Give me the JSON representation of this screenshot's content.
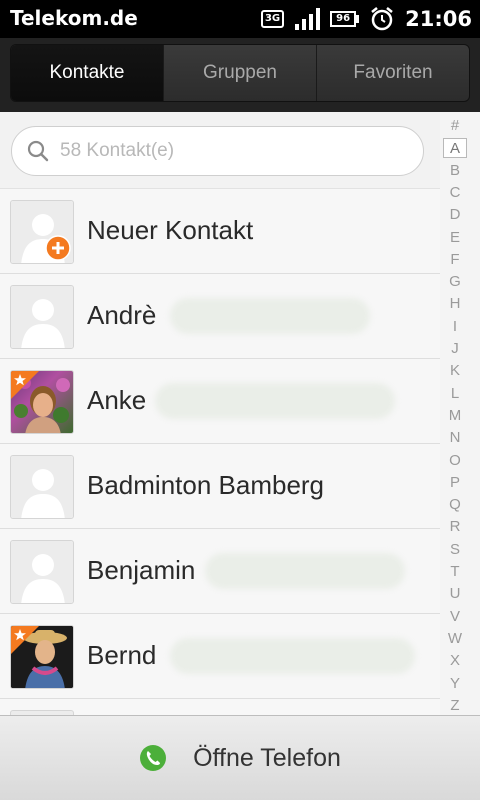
{
  "statusbar": {
    "carrier": "Telekom.de",
    "network": "3G",
    "battery": "96",
    "time": "21:06"
  },
  "tabs": [
    {
      "label": "Kontakte",
      "active": true
    },
    {
      "label": "Gruppen",
      "active": false
    },
    {
      "label": "Favoriten",
      "active": false
    }
  ],
  "search": {
    "placeholder": "58 Kontakt(e)"
  },
  "index": [
    "#",
    "A",
    "B",
    "C",
    "D",
    "E",
    "F",
    "G",
    "H",
    "I",
    "J",
    "K",
    "L",
    "M",
    "N",
    "O",
    "P",
    "Q",
    "R",
    "S",
    "T",
    "U",
    "V",
    "W",
    "X",
    "Y",
    "Z"
  ],
  "index_selected": "A",
  "contacts": [
    {
      "name": "Neuer Kontakt"
    },
    {
      "name": "Andrè"
    },
    {
      "name": "Anke",
      "favorite": true
    },
    {
      "name": "Badminton Bamberg"
    },
    {
      "name": "Benjamin"
    },
    {
      "name": "Bernd",
      "favorite": true
    }
  ],
  "bottom": {
    "label": "Öffne Telefon"
  },
  "colors": {
    "accent": "#f47a20",
    "phone_green": "#4caf3a"
  }
}
